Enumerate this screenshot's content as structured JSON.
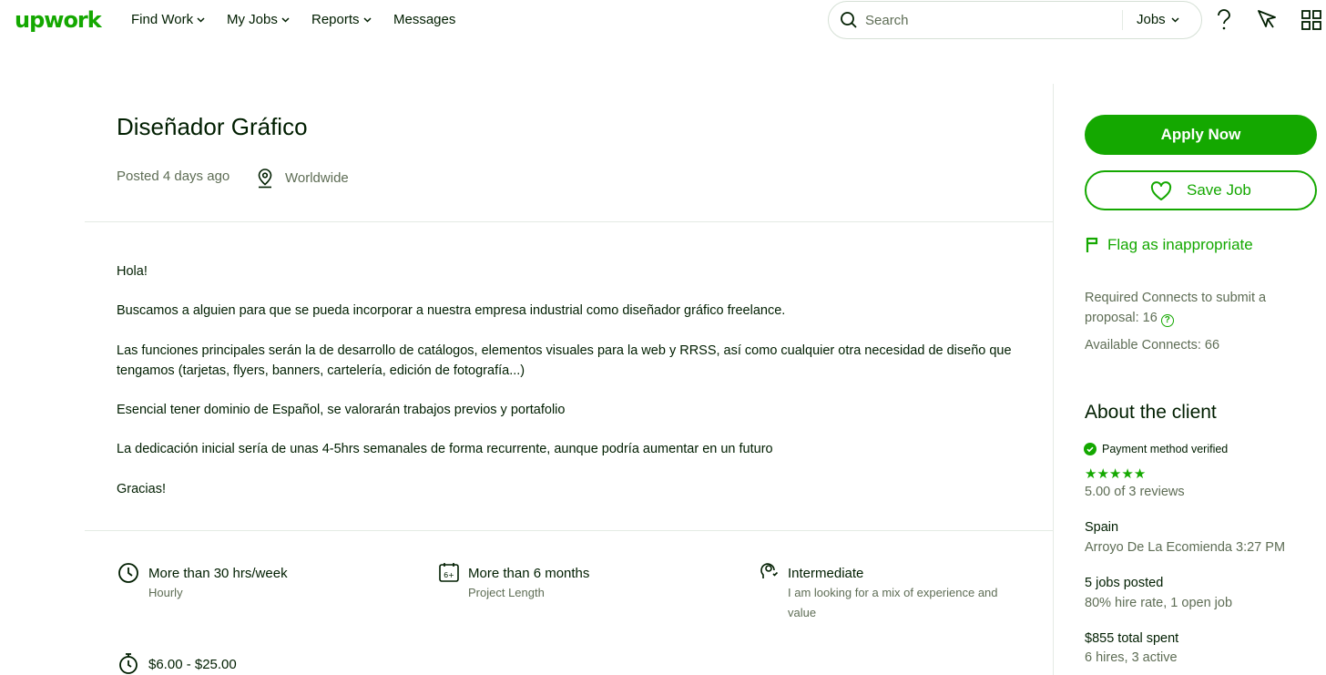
{
  "header": {
    "logo": "upwork",
    "nav": [
      {
        "label": "Find Work",
        "has_dropdown": true
      },
      {
        "label": "My Jobs",
        "has_dropdown": true
      },
      {
        "label": "Reports",
        "has_dropdown": true
      },
      {
        "label": "Messages",
        "has_dropdown": false
      }
    ],
    "search": {
      "placeholder": "Search",
      "scope": "Jobs"
    },
    "icons": [
      "help-icon",
      "direct-contracts-icon",
      "apps-grid-icon"
    ]
  },
  "job": {
    "title": "Diseñador Gráfico",
    "posted": "Posted 4 days ago",
    "location": "Worldwide",
    "description": [
      "Hola!",
      "Buscamos a alguien para que se pueda incorporar a nuestra empresa industrial como diseñador gráfico freelance.",
      "Las funciones principales serán la de desarrollo de catálogos, elementos visuales para la web y RRSS, así como cualquier otra necesidad de diseño que tengamos (tarjetas, flyers, banners, cartelería, edición de fotografía...)",
      "Esencial tener dominio de Español, se valorarán trabajos previos y portafolio",
      "La dedicación inicial sería de unas 4-5hrs semanales de forma recurrente, aunque podría aumentar en un futuro",
      "Gracias!"
    ],
    "features": [
      {
        "icon": "clock-icon",
        "title": "More than 30 hrs/week",
        "subtitle": "Hourly"
      },
      {
        "icon": "calendar-icon",
        "title": "More than 6 months",
        "subtitle": "Project Length",
        "badge": "6+"
      },
      {
        "icon": "experience-level-icon",
        "title": "Intermediate",
        "subtitle": "I am looking for a mix of experience and value"
      },
      {
        "icon": "timer-icon",
        "title": "$6.00 - $25.00",
        "subtitle": ""
      }
    ]
  },
  "sidebar": {
    "apply_label": "Apply Now",
    "save_label": "Save Job",
    "flag_label": "Flag as inappropriate",
    "connects_required": "Required Connects to submit a proposal: 16",
    "connects_available": "Available Connects: 66"
  },
  "client": {
    "heading": "About the client",
    "payment": "Payment method verified",
    "rating": 5,
    "reviews": "5.00 of 3 reviews",
    "country": "Spain",
    "city_time": "Arroyo De La Ecomienda 3:27 PM",
    "jobs_posted": "5 jobs posted",
    "hire_rate": "80% hire rate, 1 open job",
    "total_spent": "$855 total spent",
    "hires": "6 hires, 3 active"
  },
  "colors": {
    "brand": "#14a800",
    "text": "#001e00",
    "muted": "#5e6d55",
    "border": "#e4ebe4"
  }
}
